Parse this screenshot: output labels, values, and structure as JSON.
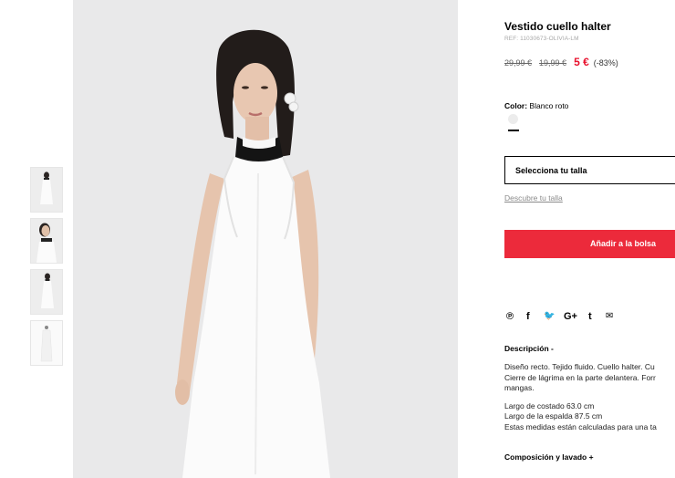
{
  "product": {
    "title": "Vestido cuello halter",
    "ref": "REF: 11030673-OLIVIA-LM",
    "price_original": "29,99 €",
    "price_previous": "19,99 €",
    "price_current": "5 €",
    "discount": "(-83%)"
  },
  "color": {
    "label": "Color:",
    "value": "Blanco roto",
    "swatch_color": "#ececec"
  },
  "size": {
    "select_label": "Selecciona tu talla",
    "guide_link": "Descubre tu talla"
  },
  "cart": {
    "add_label": "Añadir a la bolsa",
    "button_color": "#ec2a3b"
  },
  "social": {
    "icons": [
      "pinterest-icon",
      "facebook-icon",
      "twitter-icon",
      "google-plus-icon",
      "tumblr-icon",
      "email-icon"
    ],
    "glyphs": [
      "℗",
      "f",
      "🐦",
      "G+",
      "t",
      "✉"
    ]
  },
  "description": {
    "heading": "Descripción -",
    "line1": "Diseño recto. Tejido fluido. Cuello halter. Cu",
    "line2": "Cierre de lágrima en la parte delantera. Forr",
    "line3": "mangas.",
    "line4": "Largo de costado 63.0 cm",
    "line5": "Largo de la espalda 87.5 cm",
    "line6": "Estas medidas están calculadas para una ta"
  },
  "composition": {
    "heading": "Composición y lavado +"
  },
  "gallery": {
    "thumbnails": [
      "front-view",
      "detail-view",
      "side-view",
      "back-view"
    ]
  }
}
